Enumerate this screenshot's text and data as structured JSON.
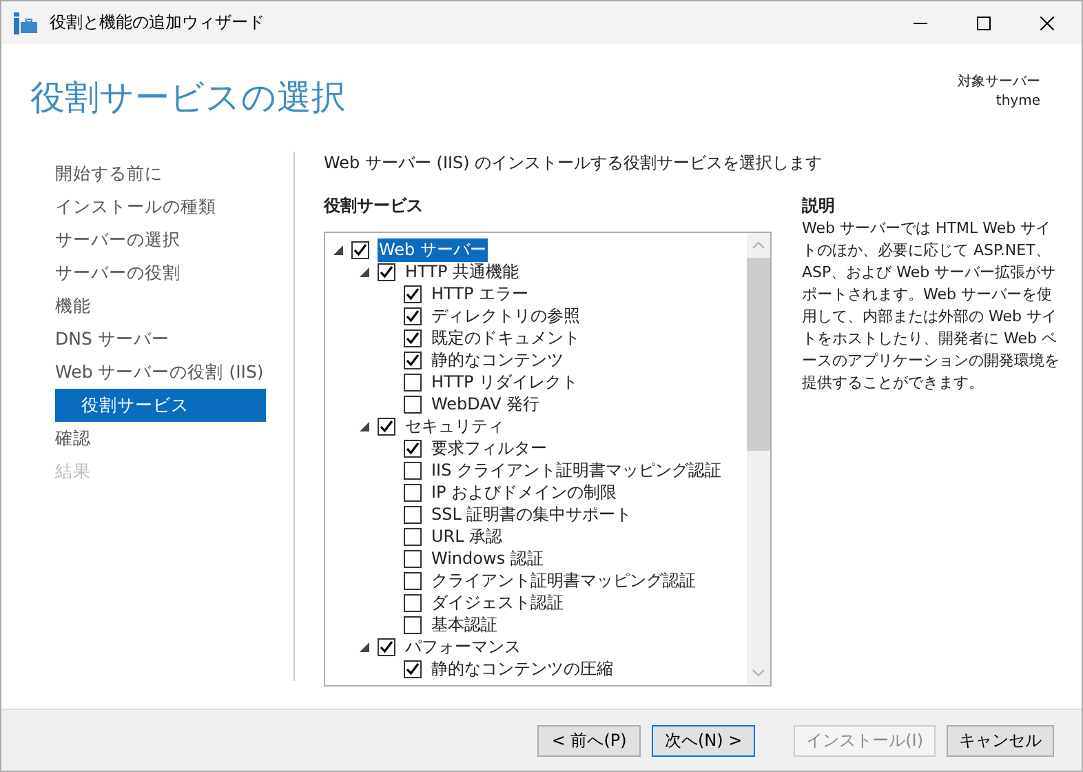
{
  "window": {
    "title": "役割と機能の追加ウィザード"
  },
  "page": {
    "title": "役割サービスの選択",
    "target_label": "対象サーバー",
    "target_server": "thyme"
  },
  "nav": [
    {
      "label": "開始する前に",
      "selected": false,
      "disabled": false
    },
    {
      "label": "インストールの種類",
      "selected": false,
      "disabled": false
    },
    {
      "label": "サーバーの選択",
      "selected": false,
      "disabled": false
    },
    {
      "label": "サーバーの役割",
      "selected": false,
      "disabled": false
    },
    {
      "label": "機能",
      "selected": false,
      "disabled": false
    },
    {
      "label": "DNS サーバー",
      "selected": false,
      "disabled": false
    },
    {
      "label": "Web サーバーの役割 (IIS)",
      "selected": false,
      "disabled": false,
      "children": [
        {
          "label": "役割サービス",
          "selected": true,
          "disabled": false
        }
      ]
    },
    {
      "label": "確認",
      "selected": false,
      "disabled": false
    },
    {
      "label": "結果",
      "selected": false,
      "disabled": true
    }
  ],
  "instruction": "Web サーバー (IIS) のインストールする役割サービスを選択します",
  "tree": {
    "heading": "役割サービス",
    "items": [
      {
        "label": "Web サーバー",
        "checked": true,
        "selected": true,
        "expanded": true,
        "children": [
          {
            "label": "HTTP 共通機能",
            "checked": true,
            "selected": false,
            "expanded": true,
            "children": [
              {
                "label": "HTTP エラー",
                "checked": true,
                "selected": false
              },
              {
                "label": "ディレクトリの参照",
                "checked": true,
                "selected": false
              },
              {
                "label": "既定のドキュメント",
                "checked": true,
                "selected": false
              },
              {
                "label": "静的なコンテンツ",
                "checked": true,
                "selected": false
              },
              {
                "label": "HTTP リダイレクト",
                "checked": false,
                "selected": false
              },
              {
                "label": "WebDAV 発行",
                "checked": false,
                "selected": false
              }
            ]
          },
          {
            "label": "セキュリティ",
            "checked": true,
            "selected": false,
            "expanded": true,
            "children": [
              {
                "label": "要求フィルター",
                "checked": true,
                "selected": false
              },
              {
                "label": "IIS クライアント証明書マッピング認証",
                "checked": false,
                "selected": false
              },
              {
                "label": "IP およびドメインの制限",
                "checked": false,
                "selected": false
              },
              {
                "label": "SSL 証明書の集中サポート",
                "checked": false,
                "selected": false
              },
              {
                "label": "URL 承認",
                "checked": false,
                "selected": false
              },
              {
                "label": "Windows 認証",
                "checked": false,
                "selected": false
              },
              {
                "label": "クライアント証明書マッピング認証",
                "checked": false,
                "selected": false
              },
              {
                "label": "ダイジェスト認証",
                "checked": false,
                "selected": false
              },
              {
                "label": "基本認証",
                "checked": false,
                "selected": false
              }
            ]
          },
          {
            "label": "パフォーマンス",
            "checked": true,
            "selected": false,
            "expanded": true,
            "children": [
              {
                "label": "静的なコンテンツの圧縮",
                "checked": true,
                "selected": false
              }
            ]
          }
        ]
      }
    ]
  },
  "description": {
    "heading": "説明",
    "text": "Web サーバーでは HTML Web サイトのほか、必要に応じて ASP.NET、ASP、および Web サーバー拡張がサポートされます。Web サーバーを使用して、内部または外部の Web サイトをホストしたり、開発者に Web ベースのアプリケーションの開発環境を提供することができます。"
  },
  "buttons": [
    {
      "label": "< 前へ(P)",
      "default": false,
      "disabled": false
    },
    {
      "label": "次へ(N) >",
      "default": true,
      "disabled": false
    },
    {
      "label": "インストール(I)",
      "default": false,
      "disabled": true
    },
    {
      "label": "キャンセル",
      "default": false,
      "disabled": false
    }
  ]
}
